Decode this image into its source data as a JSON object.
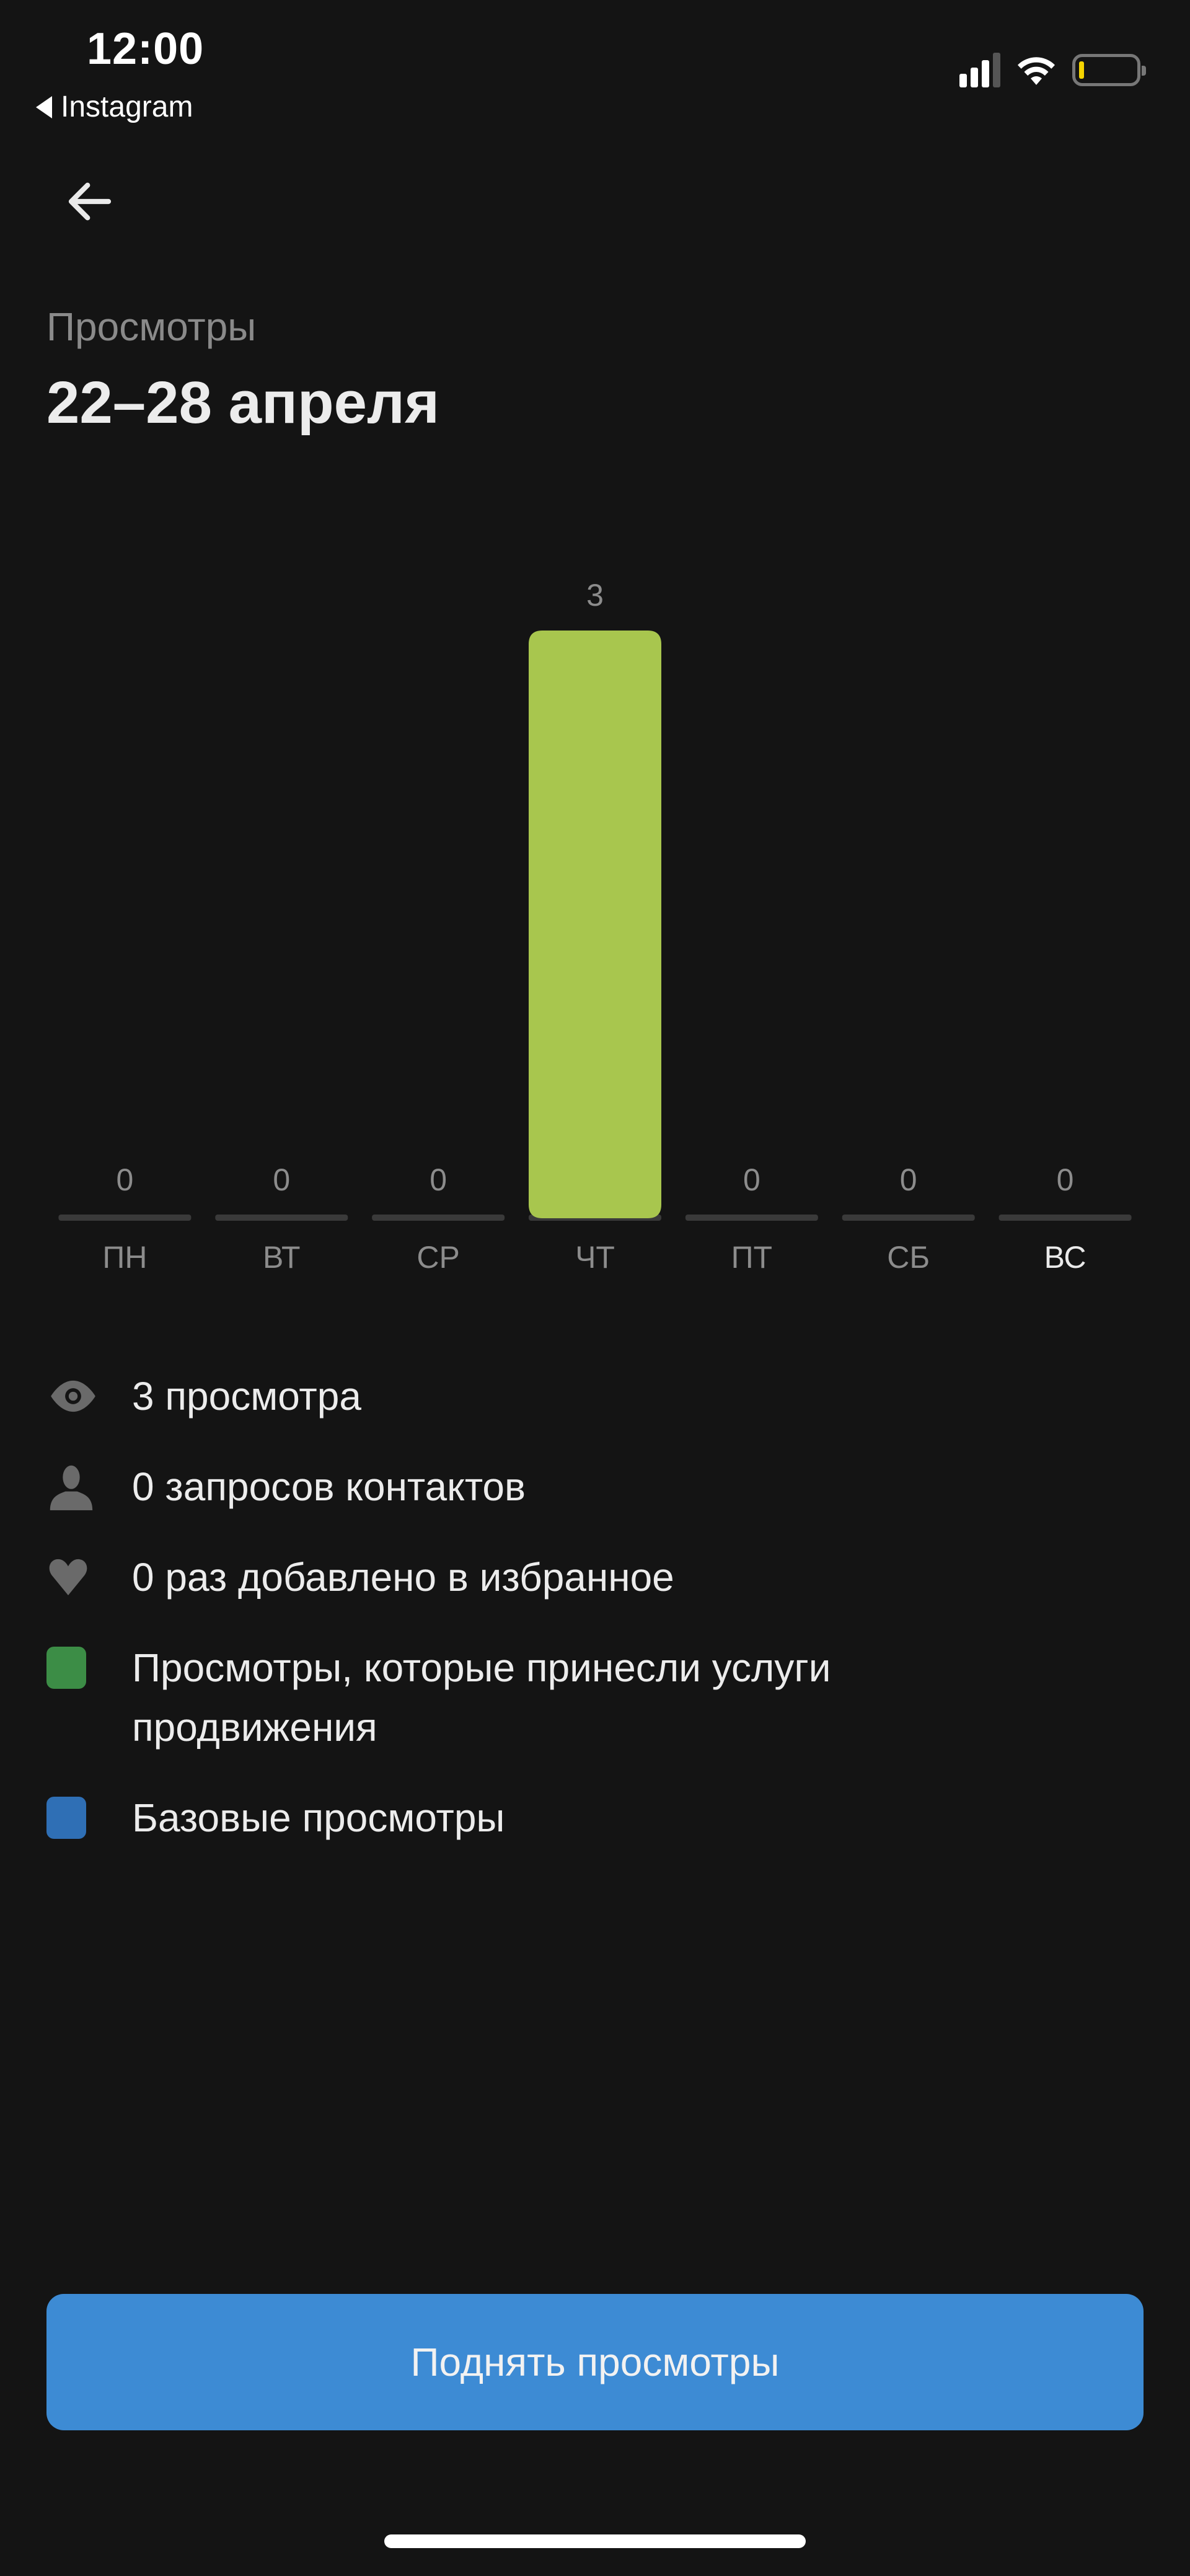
{
  "status_bar": {
    "time": "12:00",
    "back_app_label": "Instagram",
    "icons": [
      "cellular-signal-icon",
      "wifi-icon",
      "battery-low-icon"
    ],
    "battery_color": "#f5d400"
  },
  "nav": {
    "back_icon": "arrow-left-icon"
  },
  "header": {
    "subtitle": "Просмотры",
    "title": "22–28 апреля"
  },
  "chart_data": {
    "type": "bar",
    "title": "Просмотры",
    "subtitle": "22–28 апреля",
    "categories": [
      "ПН",
      "ВТ",
      "СР",
      "ЧТ",
      "ПТ",
      "СБ",
      "ВС"
    ],
    "values": [
      0,
      0,
      0,
      3,
      0,
      0,
      0
    ],
    "value_labels": [
      "0",
      "0",
      "0",
      "3",
      "0",
      "0",
      "0"
    ],
    "highlighted_category": "ВС",
    "bar_color": "#a8c64e",
    "baseline_color": "#3a3a3a",
    "xlabel": "",
    "ylabel": "",
    "ylim": [
      0,
      3
    ],
    "grid": false,
    "legend": [
      {
        "label": "Просмотры, которые принесли услуги продвижения",
        "color": "#3c8d46"
      },
      {
        "label": "Базовые просмотры",
        "color": "#2f6fb5"
      }
    ]
  },
  "stats": [
    {
      "icon": "eye-icon",
      "text": "3 просмотра"
    },
    {
      "icon": "person-icon",
      "text": "0 запросов контактов"
    },
    {
      "icon": "heart-icon",
      "text": "0 раз добавлено в избранное"
    }
  ],
  "legend": [
    {
      "text": "Просмотры, которые принесли услуги продвижения",
      "color": "#3c8d46"
    },
    {
      "text": "Базовые просмотры",
      "color": "#2f6fb5"
    }
  ],
  "cta": {
    "label": "Поднять просмотры",
    "color": "#3d8bd4"
  }
}
